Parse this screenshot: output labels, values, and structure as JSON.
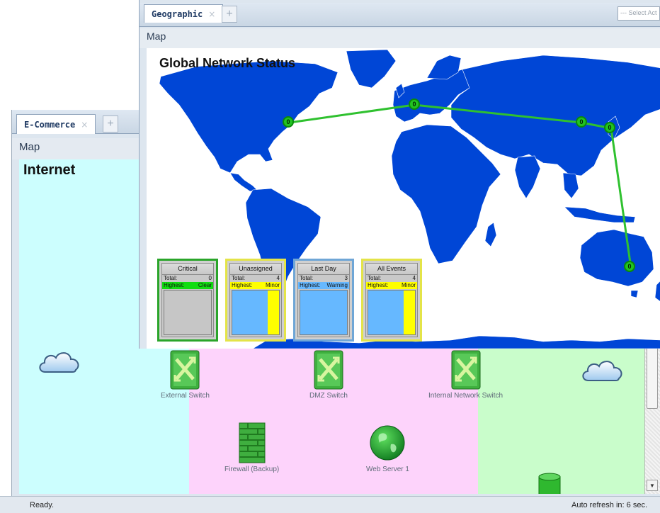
{
  "ecommerce": {
    "tab_label": "E-Commerce",
    "close_glyph": "×",
    "add_glyph": "+",
    "pane_title": "Map",
    "map_title": "Internet",
    "nodes": [
      {
        "label": "External Switch",
        "icon": "network-switch-icon"
      },
      {
        "label": "DMZ Switch",
        "icon": "network-switch-icon"
      },
      {
        "label": "Internal Network Switch",
        "icon": "network-switch-icon"
      },
      {
        "label": "Firewall (Backup)",
        "icon": "firewall-icon"
      },
      {
        "label": "Web Server 1",
        "icon": "globe-server-icon"
      },
      {
        "label": "",
        "icon": "database-icon"
      }
    ],
    "zone_colors": {
      "internet": "#ccfefe",
      "dmz": "#fdd3fb",
      "internal": "#c9fdcb"
    }
  },
  "geographic": {
    "tab_label": "Geographic",
    "close_glyph": "×",
    "add_glyph": "+",
    "select_placeholder": "--- Select Act",
    "pane_title": "Map",
    "map_title": "Global Network Status",
    "land_color": "#0046d6",
    "link_color": "#2fc12f",
    "site_counts": [
      "0",
      "0",
      "0",
      "0",
      "0"
    ],
    "panels": [
      {
        "title": "Critical",
        "total_label": "Total:",
        "total": "0",
        "highest_label": "Highest:",
        "highest": "Clear",
        "border": "#2aa52a",
        "highlight": "#11dd11",
        "blue_share": 0,
        "yellow_share": 0
      },
      {
        "title": "Unassigned",
        "total_label": "Total:",
        "total": "4",
        "highest_label": "Highest:",
        "highest": "Minor",
        "border": "#e4e448",
        "highlight": "#ffff00",
        "blue_share": 0.75,
        "yellow_share": 0.25
      },
      {
        "title": "Last Day",
        "total_label": "Total:",
        "total": "3",
        "highest_label": "Highest:",
        "highest": "Warning",
        "border": "#6fa6d6",
        "highlight": "#66b8ff",
        "blue_share": 1,
        "yellow_share": 0
      },
      {
        "title": "All Events",
        "total_label": "Total:",
        "total": "4",
        "highest_label": "Highest:",
        "highest": "Minor",
        "border": "#e4e448",
        "highlight": "#ffff00",
        "blue_share": 0.75,
        "yellow_share": 0.25
      }
    ]
  },
  "status": {
    "left": "Ready.",
    "right": "Auto refresh in: 6 sec."
  }
}
